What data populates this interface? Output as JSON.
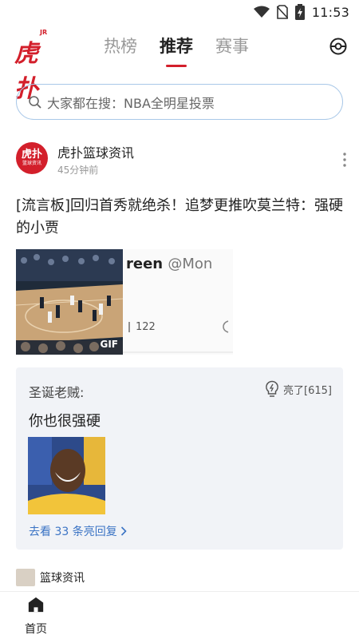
{
  "status_bar": {
    "time": "11:53"
  },
  "header": {
    "logo_text": "虎扑",
    "logo_super": "JR",
    "tabs": [
      {
        "label": "热榜",
        "active": false
      },
      {
        "label": "推荐",
        "active": true
      },
      {
        "label": "赛事",
        "active": false
      }
    ]
  },
  "search": {
    "placeholder": "大家都在搜：NBA全明星投票"
  },
  "post": {
    "author": "虎扑篮球资讯",
    "avatar_text_top": "虎扑",
    "avatar_text_bottom": "篮球资讯",
    "time": "45分钟前",
    "title": "[流言板]回归首秀就绝杀！追梦更推吹莫兰特：强硬的小贾",
    "gif_badge": "GIF",
    "tweet_name": "reen",
    "tweet_handle": "@Mon",
    "tweet_count": "122"
  },
  "top_comment": {
    "author": "圣诞老贼:",
    "light_label": "亮了[615]",
    "text": "你也很强硬",
    "more_replies": "去看 33 条亮回复"
  },
  "next_post": {
    "author": "篮球资讯"
  },
  "bottom_tab": {
    "home_label": "首页"
  },
  "colors": {
    "brand_red": "#d31f2b",
    "link_blue": "#3a73c4",
    "search_border": "#a9c8e8"
  }
}
